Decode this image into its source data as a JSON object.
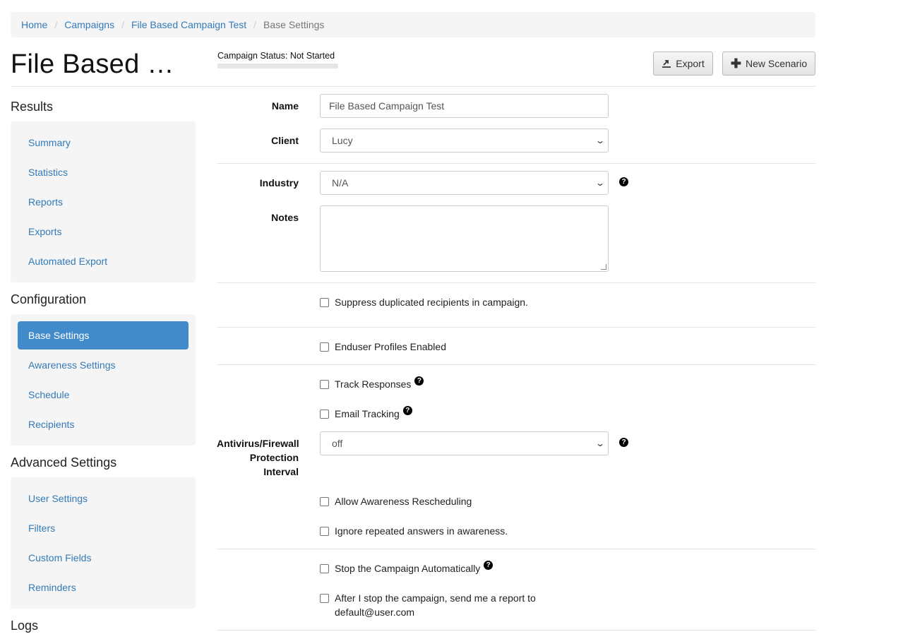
{
  "breadcrumb": {
    "home": "Home",
    "campaigns": "Campaigns",
    "campaign": "File Based Campaign Test",
    "current": "Base Settings",
    "separator": "/"
  },
  "header": {
    "title": "File Based …",
    "status_label": "Campaign Status:  Not Started",
    "export_label": "Export",
    "new_scenario_label": "New Scenario"
  },
  "sidebar": {
    "results_heading": "Results",
    "results": [
      "Summary",
      "Statistics",
      "Reports",
      "Exports",
      "Automated Export"
    ],
    "configuration_heading": "Configuration",
    "configuration": [
      "Base Settings",
      "Awareness Settings",
      "Schedule",
      "Recipients"
    ],
    "active_item": "Base Settings",
    "advanced_heading": "Advanced Settings",
    "advanced": [
      "User Settings",
      "Filters",
      "Custom Fields",
      "Reminders"
    ],
    "logs_heading": "Logs"
  },
  "form": {
    "name_label": "Name",
    "name_value": "File Based Campaign Test",
    "client_label": "Client",
    "client_value": "Lucy",
    "industry_label": "Industry",
    "industry_value": "N/A",
    "notes_label": "Notes",
    "notes_value": "",
    "suppress_label": "Suppress duplicated recipients in campaign.",
    "enduser_label": "Enduser Profiles Enabled",
    "track_label": "Track Responses",
    "email_tracking_label": "Email Tracking",
    "antivirus_label_1": "Antivirus/Firewall",
    "antivirus_label_2": "Protection",
    "antivirus_label_3": "Interval",
    "antivirus_value": "off",
    "allow_resched_label": "Allow Awareness Rescheduling",
    "ignore_repeated_label": "Ignore repeated answers in awareness.",
    "stop_auto_label": "Stop the Campaign Automatically",
    "after_stop_label_1": "After I stop the campaign, send me a report to",
    "after_stop_label_2": "default@user.com"
  },
  "icons": {
    "help": "?",
    "chevron": "⌄",
    "plus": "✚",
    "export": "⇱"
  },
  "colors": {
    "link": "#337ab7",
    "active_nav": "#428bca",
    "panel_bg": "#f5f5f5"
  }
}
